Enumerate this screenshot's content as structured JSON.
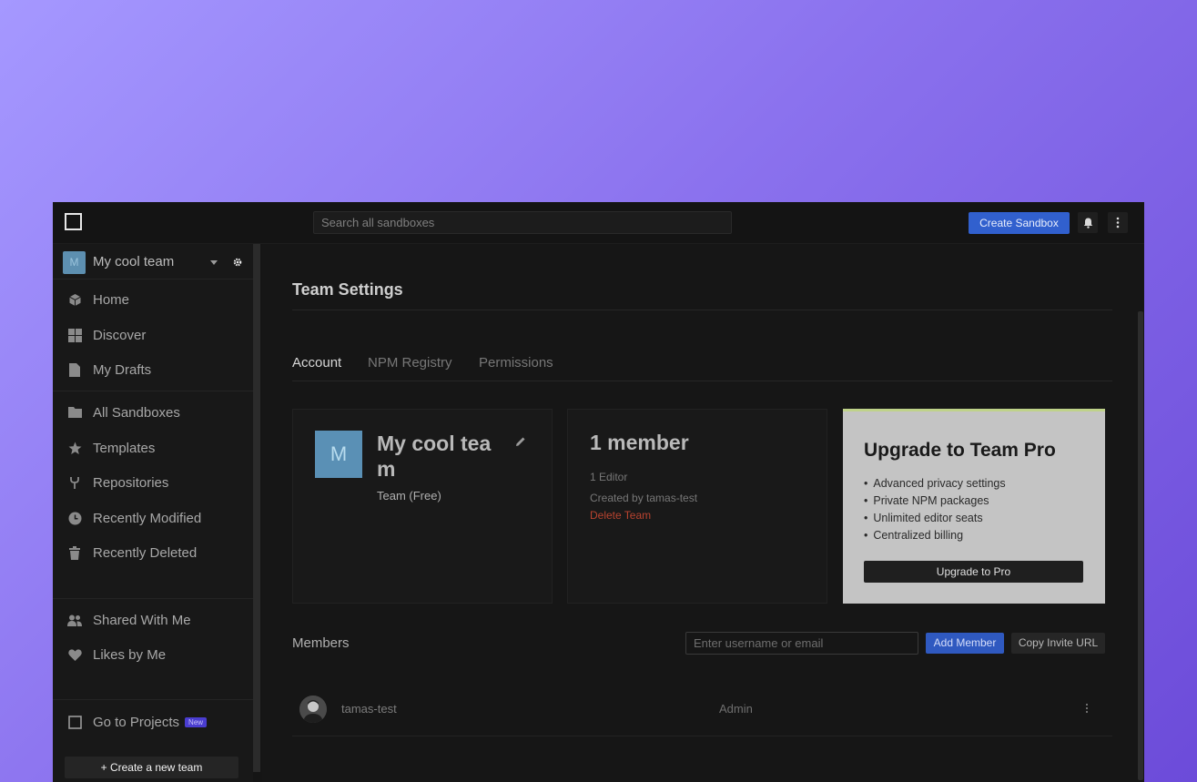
{
  "topbar": {
    "search_placeholder": "Search all sandboxes",
    "create_sandbox_label": "Create Sandbox"
  },
  "sidebar": {
    "team_initial": "M",
    "team_name": "My cool team",
    "items_group1": [
      {
        "label": "Home",
        "icon": "cube-icon"
      },
      {
        "label": "Discover",
        "icon": "grid-icon"
      },
      {
        "label": "My Drafts",
        "icon": "file-icon"
      }
    ],
    "items_group2": [
      {
        "label": "All Sandboxes",
        "icon": "folder-icon"
      },
      {
        "label": "Templates",
        "icon": "star-icon"
      },
      {
        "label": "Repositories",
        "icon": "branch-icon"
      },
      {
        "label": "Recently Modified",
        "icon": "clock-icon"
      },
      {
        "label": "Recently Deleted",
        "icon": "trash-icon"
      }
    ],
    "items_group3": [
      {
        "label": "Shared With Me",
        "icon": "people-icon"
      },
      {
        "label": "Likes by Me",
        "icon": "heart-icon"
      }
    ],
    "projects_label": "Go to Projects",
    "projects_badge": "New",
    "create_team_label": "+ Create a new team"
  },
  "main": {
    "title": "Team Settings",
    "tabs": [
      {
        "label": "Account",
        "active": true
      },
      {
        "label": "NPM Registry",
        "active": false
      },
      {
        "label": "Permissions",
        "active": false
      }
    ],
    "team_card": {
      "initial": "M",
      "name": "My cool team",
      "plan": "Team (Free)"
    },
    "members_card": {
      "count": "1 member",
      "editors": "1 Editor",
      "created_by": "Created by tamas-test",
      "delete_label": "Delete Team"
    },
    "pro_card": {
      "title": "Upgrade to Team Pro",
      "features": [
        "Advanced privacy settings",
        "Private NPM packages",
        "Unlimited editor seats",
        "Centralized billing"
      ],
      "button_label": "Upgrade to Pro"
    },
    "members": {
      "title": "Members",
      "input_placeholder": "Enter username or email",
      "add_label": "Add Member",
      "copy_label": "Copy Invite URL",
      "rows": [
        {
          "name": "tamas-test",
          "role": "Admin"
        }
      ]
    }
  }
}
